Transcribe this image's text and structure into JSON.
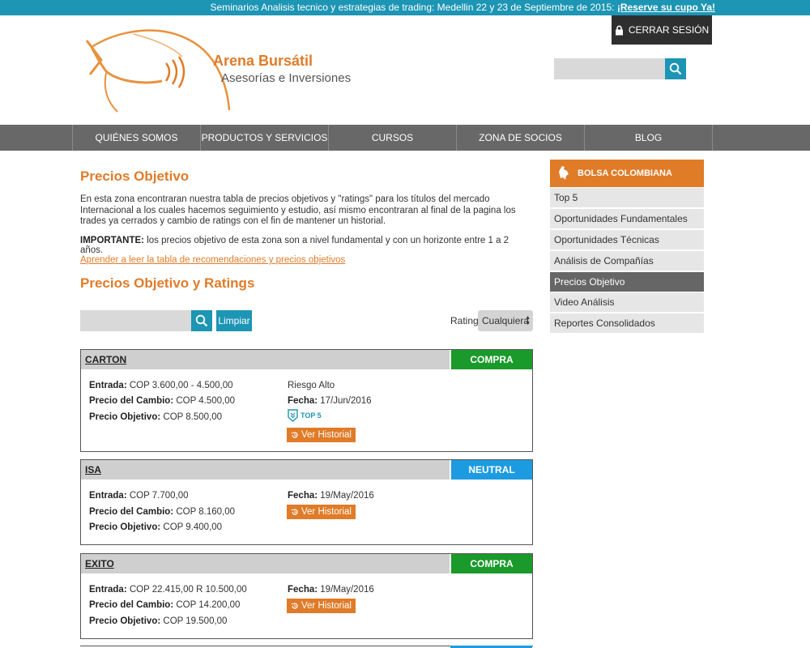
{
  "topbar": {
    "message": "Seminarios Analisis tecnico y estrategias de trading: Medellin 22 y 23 de Septiembre de 2015: ",
    "link": "¡Reserve su cupo Ya!"
  },
  "header": {
    "logout_label": "CERRAR SESIÓN",
    "brand_name": "Arena Bursátil",
    "brand_tagline": "Asesorías e Inversiones",
    "search_placeholder": ""
  },
  "nav": {
    "items": [
      {
        "label": "QUIÉNES SOMOS"
      },
      {
        "label": "PRODUCTOS Y SERVICIOS"
      },
      {
        "label": "CURSOS"
      },
      {
        "label": "ZONA DE SOCIOS"
      },
      {
        "label": "BLOG"
      }
    ]
  },
  "main": {
    "title": "Precios Objetivo",
    "intro": "En esta zona encontraran nuestra tabla de precios objetivos y \"ratings\" para los títulos del mercado Internacional a los cuales hacemos seguimiento y estudio, así mismo encontraran al final de la pagina los trades ya cerrados y cambio de ratings con el fin de mantener un historial.",
    "important_label": "IMPORTANTE:",
    "important_text": " los precios objetivo de esta zona son a nivel fundamental y con un horizonte entre 1 a 2 años.",
    "learn_link": "Aprender a leer la tabla de recomendaciones y precios objetivos",
    "section_title": "Precios Objetivo y Ratings",
    "filter": {
      "clear_label": "Limpiar",
      "rating_label": "Rating:",
      "rating_value": "Cualquiera"
    },
    "labels": {
      "entrada": "Entrada:",
      "precio_cambio": "Precio del Cambio:",
      "precio_objetivo": "Precio Objetivo:",
      "fecha": "Fecha:",
      "ver_historial": "Ver Historial"
    },
    "cards": [
      {
        "ticker": "CARTON",
        "rating": "COMPRA",
        "rating_color": "#1a9a2b",
        "entrada": " COP 3.600,00 - 4.500,00",
        "precio_cambio": " COP 4.500,00",
        "precio_objetivo": " COP 8.500,00",
        "riesgo": "Riesgo Alto",
        "fecha": " 17/Jun/2016",
        "badge": "TOP 5"
      },
      {
        "ticker": "ISA",
        "rating": "NEUTRAL",
        "rating_color": "#1d9be0",
        "entrada": " COP 7.700,00",
        "precio_cambio": " COP 8.160,00",
        "precio_objetivo": " COP 9.400,00",
        "fecha": " 19/May/2016"
      },
      {
        "ticker": "EXITO",
        "rating": "COMPRA",
        "rating_color": "#1a9a2b",
        "entrada": " COP 22.415,00 R 10.500,00",
        "precio_cambio": " COP 14.200,00",
        "precio_objetivo": " COP 19.500,00",
        "fecha": " 19/May/2016"
      }
    ]
  },
  "sidebar": {
    "header": "BOLSA COLOMBIANA",
    "items": [
      {
        "label": "Top 5"
      },
      {
        "label": "Oportunidades Fundamentales"
      },
      {
        "label": "Oportunidades Técnicas"
      },
      {
        "label": "Análisis de Compañías"
      },
      {
        "label": "Precios Objetivo",
        "active": true
      },
      {
        "label": "Video Análisis"
      },
      {
        "label": "Reportes Consolidados"
      }
    ]
  },
  "colors": {
    "accent": "#e07b28",
    "teal": "#1d95b4",
    "nav_bg": "#686868",
    "buy": "#1a9a2b",
    "neutral": "#1d9be0"
  }
}
